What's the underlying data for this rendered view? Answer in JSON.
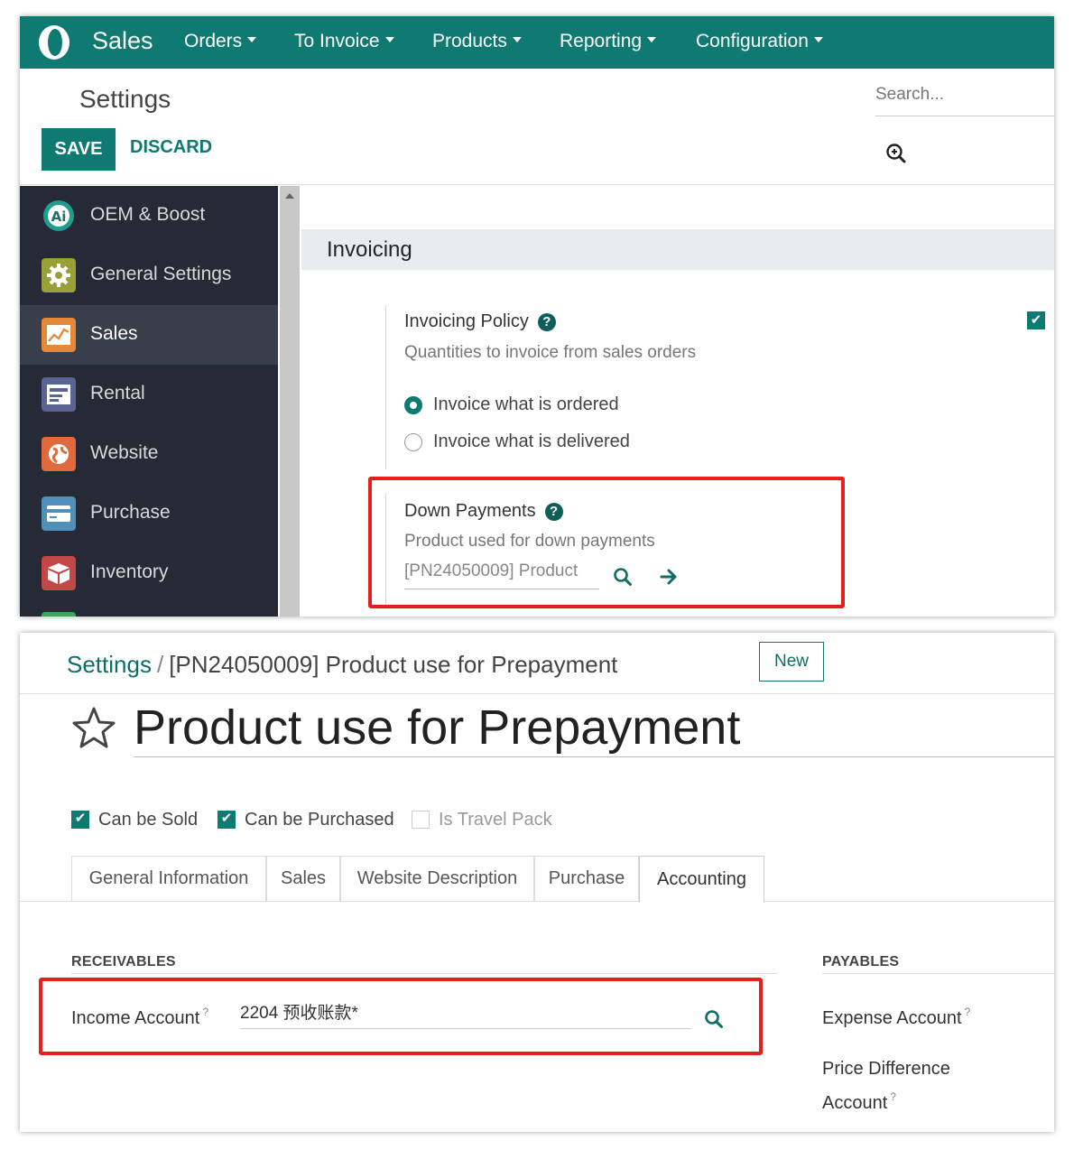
{
  "navbar": {
    "app_name": "Sales",
    "menus": [
      "Orders",
      "To Invoice",
      "Products",
      "Reporting",
      "Configuration"
    ]
  },
  "control": {
    "title": "Settings",
    "save_label": "SAVE",
    "discard_label": "DISCARD",
    "search_placeholder": "Search..."
  },
  "sidebar": {
    "items": [
      {
        "label": "OEM & Boost",
        "icon": "ai-badge-icon"
      },
      {
        "label": "General Settings",
        "icon": "gear-icon"
      },
      {
        "label": "Sales",
        "icon": "sales-chart-icon"
      },
      {
        "label": "Rental",
        "icon": "rental-icon"
      },
      {
        "label": "Website",
        "icon": "globe-icon"
      },
      {
        "label": "Purchase",
        "icon": "credit-card-icon"
      },
      {
        "label": "Inventory",
        "icon": "box-icon"
      }
    ],
    "active_index": 2
  },
  "invoicing": {
    "section_title": "Invoicing",
    "policy": {
      "title": "Invoicing Policy",
      "description": "Quantities to invoice from sales orders",
      "options": [
        "Invoice what is ordered",
        "Invoice what is delivered"
      ],
      "selected_index": 0
    },
    "down_payments": {
      "title": "Down Payments",
      "description": "Product used for down payments",
      "product_value": "[PN24050009] Product"
    }
  },
  "product": {
    "breadcrumb_root": "Settings",
    "breadcrumb_separator": "/",
    "breadcrumb_current": "[PN24050009] Product use for Prepayment",
    "new_label": "New",
    "name": "Product use for Prepayment",
    "checkboxes": [
      {
        "label": "Can be Sold",
        "checked": true
      },
      {
        "label": "Can be Purchased",
        "checked": true
      },
      {
        "label": "Is Travel Pack",
        "checked": false
      }
    ],
    "tabs": [
      "General Information",
      "Sales",
      "Website Description",
      "Purchase",
      "Accounting"
    ],
    "active_tab_index": 4,
    "receivables": {
      "title": "RECEIVABLES",
      "income_account_label": "Income Account",
      "income_account_value": "2204 预收账款*"
    },
    "payables": {
      "title": "PAYABLES",
      "expense_account_label": "Expense Account",
      "price_difference_label_1": "Price Difference",
      "price_difference_label_2": "Account"
    },
    "help_mark": "?"
  },
  "colors": {
    "brand": "#0f7a71",
    "highlight": "#e81e1e",
    "sidebar_bg": "#262a36"
  }
}
